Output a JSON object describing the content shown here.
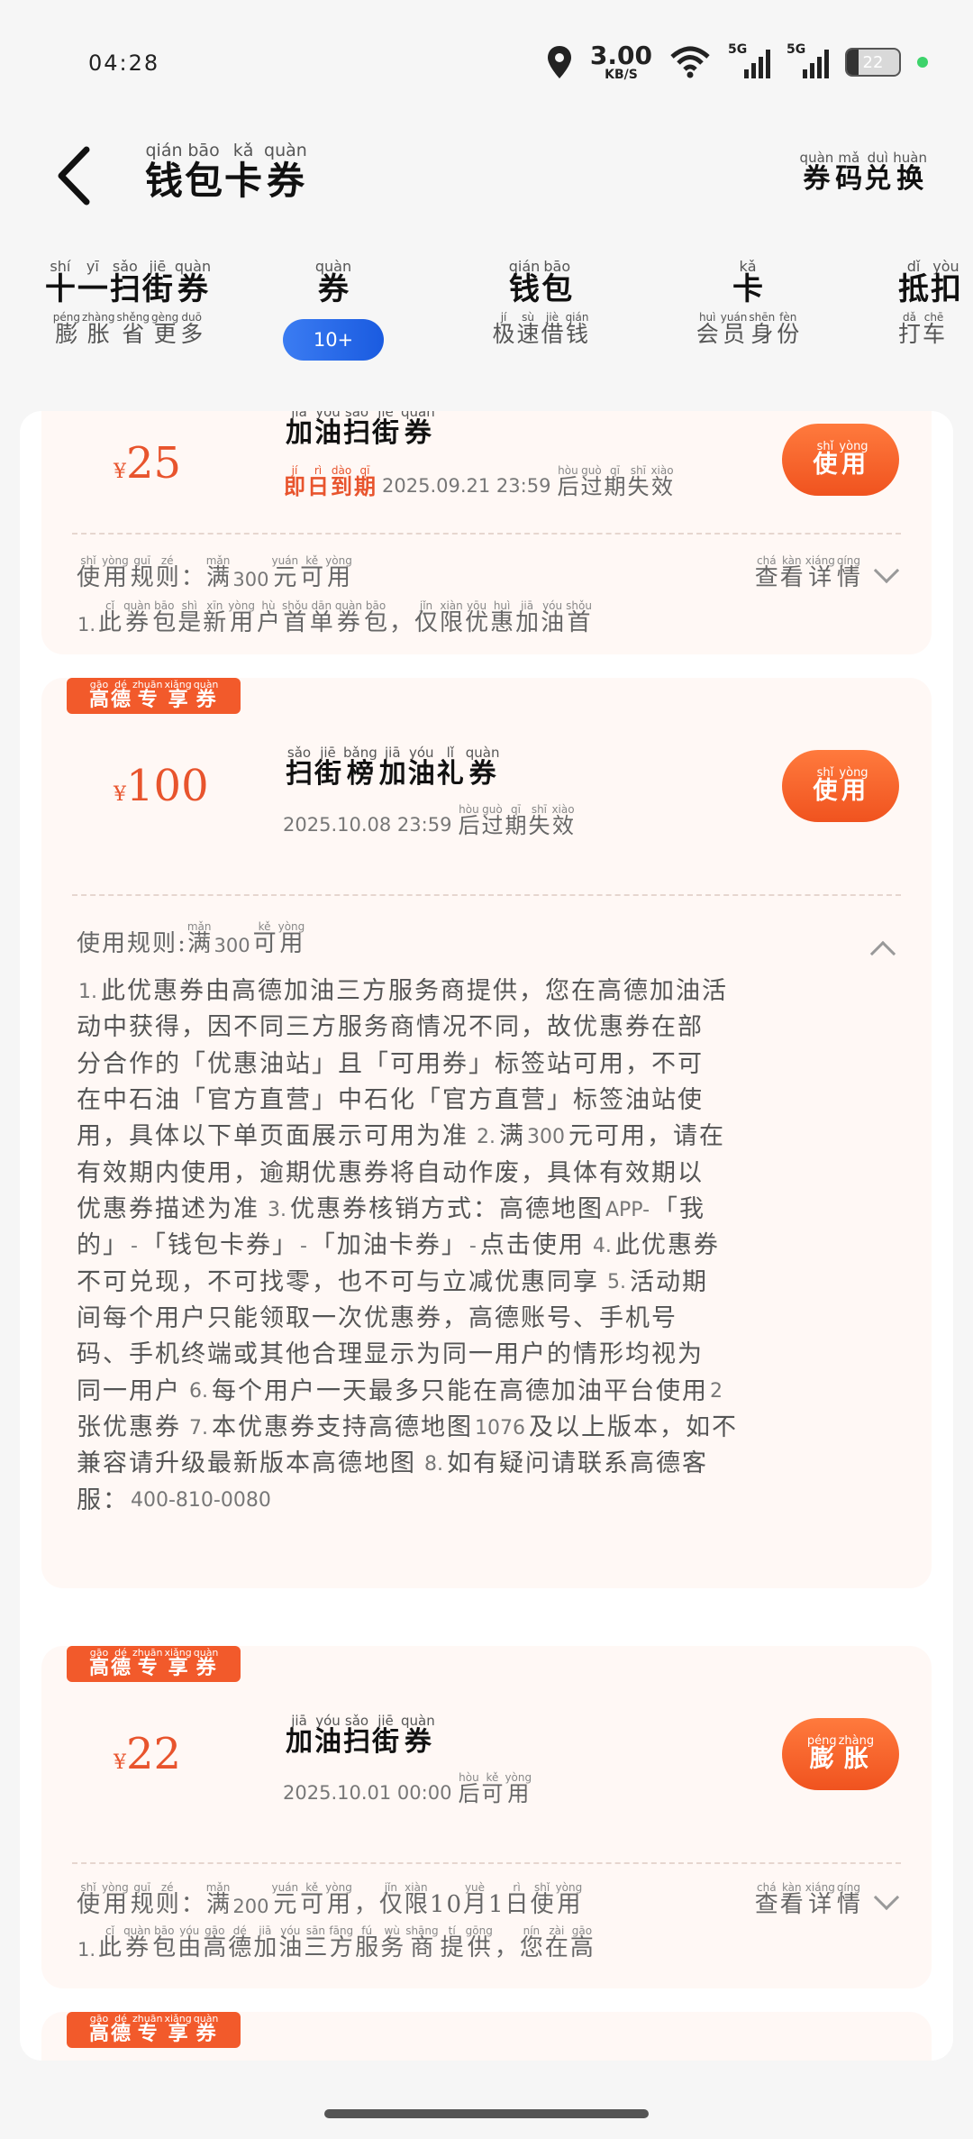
{
  "status": {
    "time": "04:28",
    "speed_value": "3.00",
    "speed_unit": "KB/S",
    "sig1": "5G",
    "sig2": "5G",
    "battery": "22"
  },
  "header": {
    "title": "钱包卡券",
    "title_py": [
      "qián",
      "bāo",
      "kǎ",
      "quàn"
    ],
    "redeem": "券码兑换",
    "redeem_py": [
      "quàn",
      "mǎ",
      "duì",
      "huàn"
    ]
  },
  "tabs": [
    {
      "label": "十一扫街券",
      "label_py": [
        "shí",
        "yī",
        "sǎo",
        "jiē",
        "quàn"
      ],
      "sub": "膨胀省更多",
      "sub_py": [
        "péng",
        "zhàng",
        "shěng",
        "gèng",
        "duō"
      ]
    },
    {
      "label": "券",
      "label_py": [
        "quàn"
      ],
      "badge": "10+"
    },
    {
      "label": "钱包",
      "label_py": [
        "qián",
        "bāo"
      ],
      "sub": "极速借钱",
      "sub_py": [
        "jí",
        "sù",
        "jiè",
        "qián"
      ]
    },
    {
      "label": "卡",
      "label_py": [
        "kǎ"
      ],
      "sub": "会员身份",
      "sub_py": [
        "huì",
        "yuán",
        "shēn",
        "fèn"
      ]
    },
    {
      "label": "抵扣",
      "label_py": [
        "dǐ",
        "yòu"
      ],
      "sub": "打车",
      "sub_py": [
        "dǎ",
        "chē"
      ]
    }
  ],
  "cards": [
    {
      "currency": "¥",
      "amount": "25",
      "name": "加油扫街券",
      "name_py": [
        "jiā",
        "yóu",
        "sǎo",
        "jiē",
        "quàn"
      ],
      "hot": "即日到期",
      "hot_py": [
        "jí",
        "rì",
        "dào",
        "qī"
      ],
      "date": "2025.09.21 23:59",
      "date_suffix": "后过期失效",
      "date_suffix_py": [
        "hòu",
        "guò",
        "qī",
        "shī",
        "xiào"
      ],
      "button": "使用",
      "button_py": [
        "shǐ",
        "yòng"
      ],
      "rule": {
        "pre": "使用规则：满",
        "pre_py": [
          "shǐ",
          "yòng",
          "guī",
          "zé",
          "",
          "mǎn"
        ],
        "num": "300",
        "post": "元可用",
        "post_py": [
          "yuán",
          "kě",
          "yòng"
        ]
      },
      "detail": "查看详情",
      "detail_py": [
        "chá",
        "kàn",
        "xiáng",
        "qíng"
      ],
      "desc_num": "1.",
      "desc": "此券包是新用户首单券包，仅限优惠加油首",
      "desc_py": [
        "cǐ",
        "quàn",
        "bāo",
        "shì",
        "xīn",
        "yòng",
        "hù",
        "shǒu",
        "dān",
        "quàn",
        "bāo",
        "",
        "jǐn",
        "xiàn",
        "yōu",
        "huì",
        "jiā",
        "yóu",
        "shǒu"
      ]
    },
    {
      "badge": "高德专享券",
      "badge_py": [
        "gāo",
        "dé",
        "zhuān",
        "xiǎng",
        "quàn"
      ],
      "currency": "¥",
      "amount": "100",
      "name": "扫街榜加油礼券",
      "name_py": [
        "sǎo",
        "jiē",
        "bǎng",
        "jiā",
        "yóu",
        "lǐ",
        "quàn"
      ],
      "date": "2025.10.08 23:59",
      "date_suffix": "后过期失效",
      "date_suffix_py": [
        "hòu",
        "guò",
        "qī",
        "shī",
        "xiào"
      ],
      "button": "使用",
      "button_py": [
        "shǐ",
        "yòng"
      ],
      "rule": {
        "pre": "使用规则:满",
        "pre_py": [
          "",
          "",
          "",
          "",
          "",
          "mǎn"
        ],
        "num": "300",
        "post": "可用",
        "post_py": [
          "kě",
          "yòng"
        ]
      },
      "full_text": [
        "1.此优惠券由高德加油三方服务商提供，您在高德加油活",
        "动中获得，因不同三方服务商情况不同，故优惠券在部",
        "分合作的「优惠油站」且「可用券」标签站可用，不可",
        "在中石油「官方直营」中石化「官方直营」标签油站使",
        "用，具体以下单页面展示可用为准 2.满300元可用，请在",
        "有效期内使用，逾期优惠券将自动作废，具体有效期以",
        "优惠券描述为准 3.优惠券核销方式：高德地图APP-「我",
        "的」-「钱包卡券」-「加油卡券」-点击使用 4.此优惠券",
        "不可兑现，不可找零，也不可与立减优惠同享 5.活动期",
        "间每个用户只能领取一次优惠券，高德账号、手机号",
        "码、手机终端或其他合理显示为同一用户的情形均视为",
        "同一用户 6.每个用户一天最多只能在高德加油平台使用2",
        "张优惠券 7.本优惠券支持高德地图1076及以上版本，如不",
        "兼容请升级最新版本高德地图 8.如有疑问请联系高德客",
        "服：400-810-0080"
      ]
    },
    {
      "badge": "高德专享券",
      "badge_py": [
        "gāo",
        "dé",
        "zhuān",
        "xiǎng",
        "quàn"
      ],
      "currency": "¥",
      "amount": "22",
      "name": "加油扫街券",
      "name_py": [
        "jiā",
        "yóu",
        "sǎo",
        "jiē",
        "quàn"
      ],
      "date": "2025.10.01 00:00",
      "date_suffix": "后可用",
      "date_suffix_py": [
        "hòu",
        "kě",
        "yòng"
      ],
      "button": "膨胀",
      "button_py": [
        "péng",
        "zhàng"
      ],
      "rule": {
        "pre": "使用规则：满",
        "pre_py": [
          "shǐ",
          "yòng",
          "guī",
          "zé",
          "",
          "mǎn"
        ],
        "num": "200",
        "post": "元可用，仅限10月1日使用",
        "post_py": [
          "yuán",
          "kě",
          "yòng",
          "",
          "jǐn",
          "xiàn",
          "",
          "",
          "yuè",
          "",
          "rì",
          "shǐ",
          "yòng"
        ]
      },
      "detail": "查看详情",
      "detail_py": [
        "chá",
        "kàn",
        "xiáng",
        "qíng"
      ],
      "desc_num": "1.",
      "desc": "此券包由高德加油三方服务商提供，您在高",
      "desc_py": [
        "cǐ",
        "quàn",
        "bāo",
        "yóu",
        "gāo",
        "dé",
        "jiā",
        "yóu",
        "sān",
        "fāng",
        "fú",
        "wù",
        "shāng",
        "tí",
        "gōng",
        "",
        "nín",
        "zài",
        "gāo"
      ]
    },
    {
      "badge": "高德专享券",
      "badge_py": [
        "gāo",
        "dé",
        "zhuān",
        "xiǎng",
        "quàn"
      ]
    }
  ],
  "colors": {
    "accent": "#f0531f",
    "badge": "#f25a2b",
    "pill": "#1a5be0",
    "card_bg": "#fff8f5"
  }
}
